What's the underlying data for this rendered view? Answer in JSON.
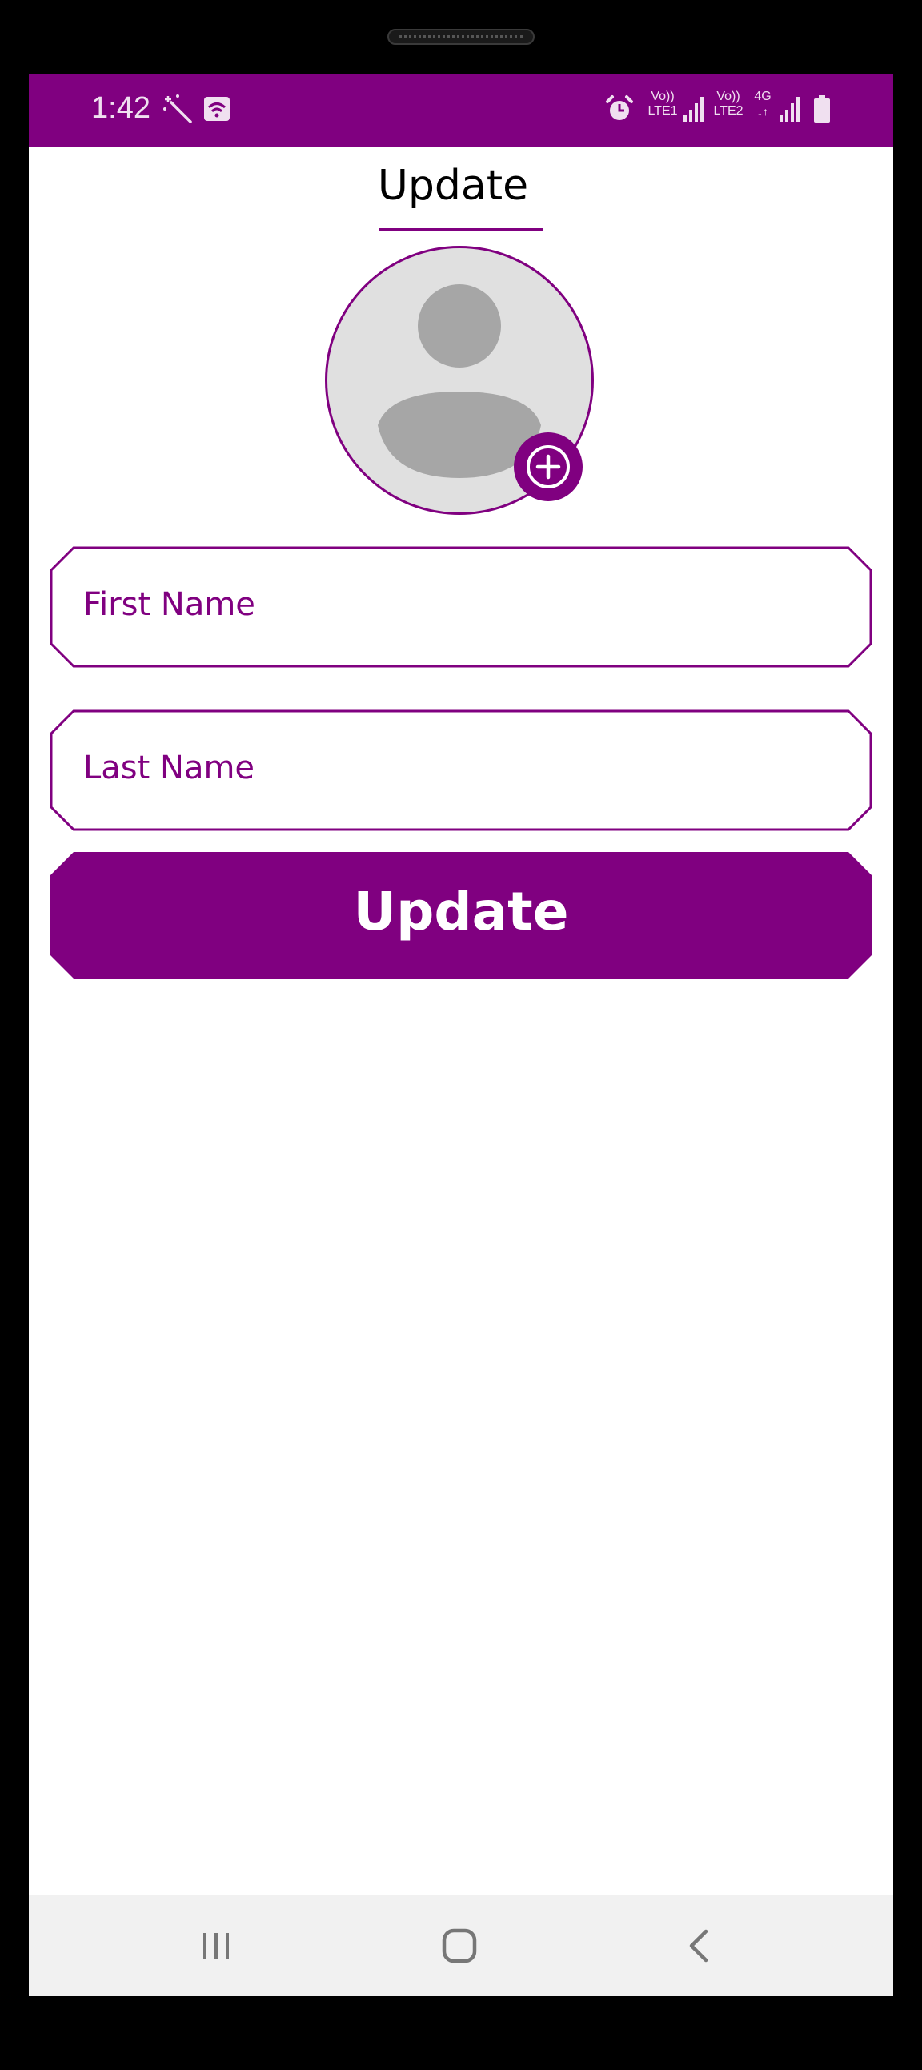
{
  "status_bar": {
    "time": "1:42",
    "icons": [
      "magic-wand-icon",
      "wifi-calling-icon",
      "alarm-icon",
      "volte-lte1-icon",
      "signal-icon",
      "volte-lte2-icon",
      "4g-icon",
      "signal-icon",
      "battery-icon"
    ],
    "lte1_text_top": "Vo))",
    "lte1_text_bottom": "LTE1",
    "lte2_text_top": "Vo))",
    "lte2_text_bottom": "LTE2",
    "network": "4G"
  },
  "header": {
    "title": "Update"
  },
  "avatar": {
    "icon": "person-placeholder-icon",
    "add_icon": "add-circle-icon"
  },
  "form": {
    "first_name_placeholder": "First Name",
    "last_name_placeholder": "Last Name",
    "submit_label": "Update"
  },
  "nav_bar": {
    "icons": [
      "recent-apps-icon",
      "home-icon",
      "back-icon"
    ]
  },
  "colors": {
    "accent": "#800080",
    "avatar_bg": "#e0e0e0",
    "avatar_fg": "#a6a6a6",
    "nav_bg": "#f1f1f1"
  }
}
